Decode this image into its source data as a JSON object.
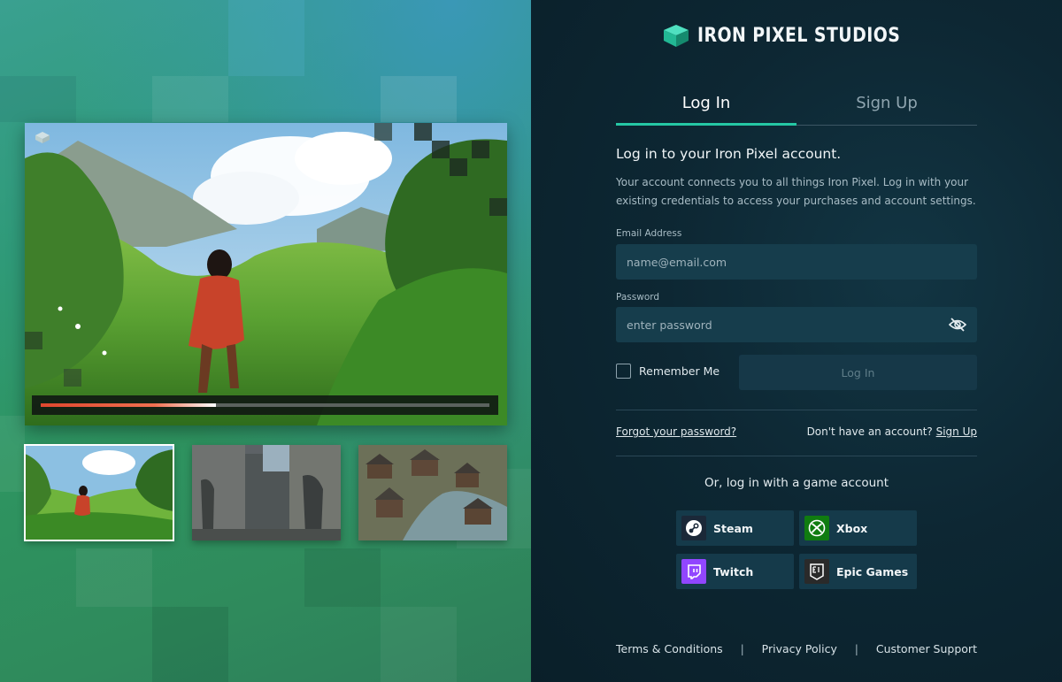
{
  "brand": {
    "name": "IRON PIXEL STUDIOS",
    "accent": "#25c7a4"
  },
  "tabs": [
    {
      "label": "Log In",
      "active": true
    },
    {
      "label": "Sign Up",
      "active": false
    }
  ],
  "login": {
    "heading": "Log in to your Iron Pixel account.",
    "description": "Your account connects you to all things Iron Pixel. Log in with your existing credentials to access your purchases and account settings.",
    "email_label": "Email Address",
    "email_placeholder": "name@email.com",
    "password_label": "Password",
    "password_placeholder": "enter password",
    "remember_label": "Remember Me",
    "submit_label": "Log In",
    "forgot_label": "Forgot your password?",
    "no_account_text": "Don't have an account?",
    "signup_link": "Sign Up"
  },
  "alt_login": {
    "heading": "Or, log in with a game account",
    "providers": [
      {
        "label": "Steam",
        "icon": "steam-icon",
        "color": "#1b2838"
      },
      {
        "label": "Xbox",
        "icon": "xbox-icon",
        "color": "#107c10"
      },
      {
        "label": "Twitch",
        "icon": "twitch-icon",
        "color": "#9146ff"
      },
      {
        "label": "Epic Games",
        "icon": "epic-games-icon",
        "color": "#2a2a2a"
      }
    ]
  },
  "footer": {
    "links": [
      "Terms & Conditions",
      "Privacy Policy",
      "Customer Support"
    ],
    "separator": "|"
  },
  "media": {
    "progress": 0.39,
    "thumbnails": [
      {
        "name": "meadow-girl",
        "active": true
      },
      {
        "name": "castle-knights",
        "active": false
      },
      {
        "name": "medieval-village",
        "active": false
      }
    ]
  }
}
